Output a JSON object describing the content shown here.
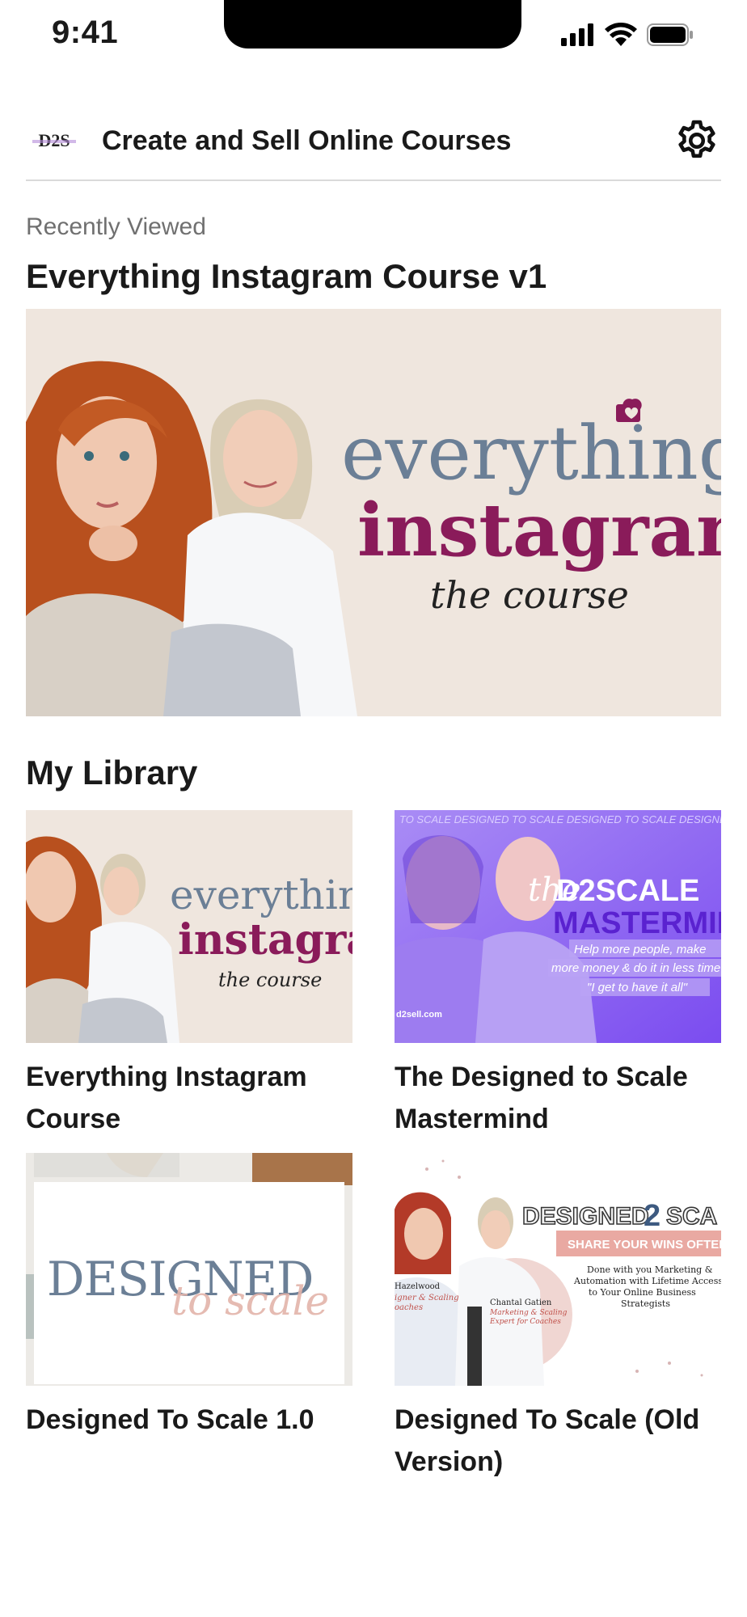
{
  "status_bar": {
    "time": "9:41"
  },
  "header": {
    "logo_text": "D2S",
    "title": "Create and Sell Online Courses"
  },
  "recently_viewed": {
    "label": "Recently Viewed",
    "title": "Everything Instagram Course v1",
    "art": {
      "line1": "everything",
      "line2": "instagram",
      "line3": "the course"
    }
  },
  "library": {
    "title": "My Library",
    "items": [
      {
        "title": "Everything Instagram Course",
        "art": {
          "line1": "everythin",
          "line2": "instagra",
          "line3": "the course"
        }
      },
      {
        "title": "The Designed to Scale Mastermind",
        "art": {
          "ticker": "TO SCALE DESIGNED TO SCALE DESIGNED TO SCALE DESIGNED",
          "script": "the",
          "line1": "D2SCALE",
          "line2": "MASTERMIN",
          "tag1": "Help more people, make",
          "tag2": "more money & do it in less time",
          "tag3": "\"I get to have it all\"",
          "url": "d2sell.com"
        }
      },
      {
        "title": "Designed To Scale 1.0",
        "art": {
          "line1": "DESIGNED",
          "line2": "to scale"
        }
      },
      {
        "title": "Designed To Scale (Old Version)",
        "art": {
          "line1": "DESIGNED",
          "line1b": "2",
          "line1c": "SCA",
          "banner": "SHARE YOUR WINS OFTEN",
          "blurb1": "Done with you Marketing &",
          "blurb2": "Automation with Lifetime Access",
          "blurb3": "to Your Online Business",
          "blurb4": "Strategists",
          "left_name": "Hazelwood",
          "left_role1": "igner & Scaling",
          "left_role2": "oaches",
          "right_name": "Chantal Gatien",
          "right_role1": "Marketing & Scaling",
          "right_role2": "Expert for Coaches"
        }
      }
    ]
  },
  "colors": {
    "accent_plum": "#8a1b5a",
    "slate": "#6b7f96",
    "beige": "#efe6de",
    "purple": "#8b5cf6"
  }
}
